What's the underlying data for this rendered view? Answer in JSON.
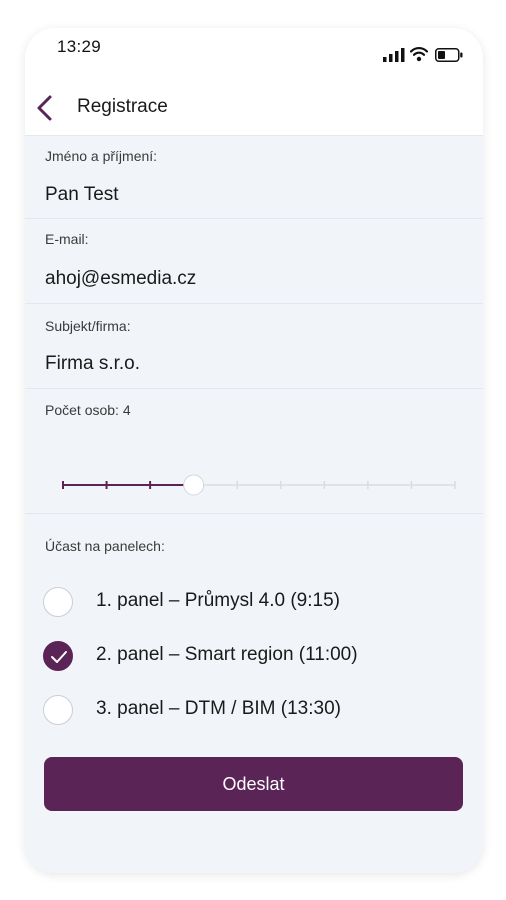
{
  "status_bar": {
    "time": "13:29"
  },
  "header": {
    "title": "Registrace"
  },
  "form": {
    "name": {
      "label": "Jméno a příjmení:",
      "value": "Pan Test"
    },
    "email": {
      "label": "E-mail:",
      "value": "ahoj@esmedia.cz"
    },
    "company": {
      "label": "Subjekt/firma:",
      "value": "Firma s.r.o."
    },
    "persons": {
      "label": "Počet osob: 4",
      "value": 4,
      "min": 1,
      "max": 10
    },
    "panels": {
      "label": "Účast na panelech:",
      "options": [
        {
          "label": "1. panel – Průmysl 4.0 (9:15)",
          "checked": false
        },
        {
          "label": "2. panel – Smart region (11:00)",
          "checked": true
        },
        {
          "label": "3. panel – DTM / BIM (13:30)",
          "checked": false
        }
      ]
    },
    "submit_label": "Odeslat"
  },
  "colors": {
    "accent": "#5b2457",
    "background": "#f1f5f9",
    "track": "#d9dde2"
  },
  "icons": [
    "back-arrow-icon",
    "signal-icon",
    "wifi-icon",
    "battery-icon",
    "checkmark-icon"
  ]
}
